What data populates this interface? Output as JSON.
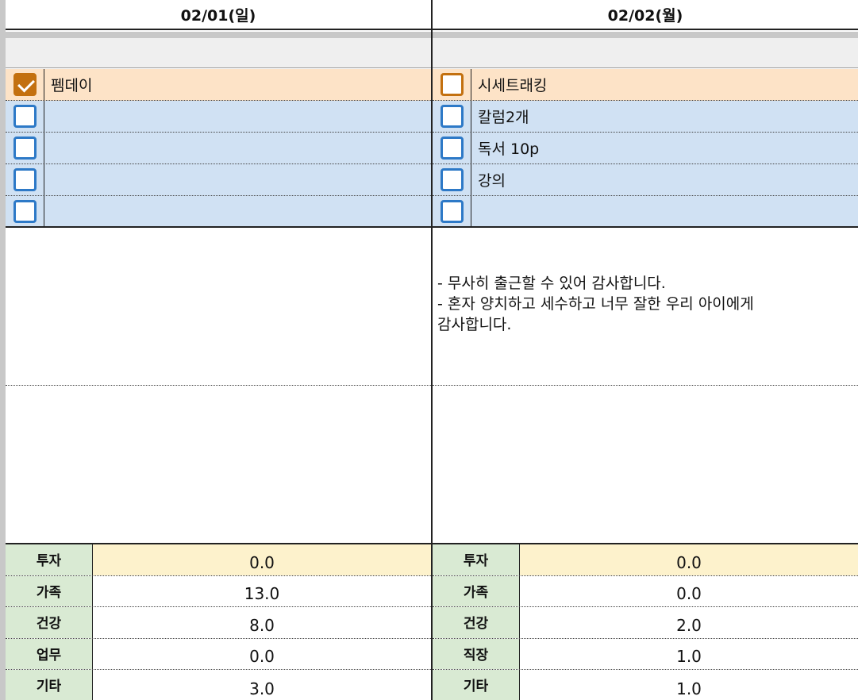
{
  "days": [
    {
      "date": "02/01(일)",
      "tasks": [
        {
          "label": "펨데이",
          "checked": true,
          "highlight": true
        },
        {
          "label": "",
          "checked": false,
          "highlight": false
        },
        {
          "label": "",
          "checked": false,
          "highlight": false
        },
        {
          "label": "",
          "checked": false,
          "highlight": false
        },
        {
          "label": "",
          "checked": false,
          "highlight": false
        }
      ],
      "note": "",
      "stats": [
        {
          "label": "투자",
          "value": "0.0"
        },
        {
          "label": "가족",
          "value": "13.0"
        },
        {
          "label": "건강",
          "value": "8.0"
        },
        {
          "label": "업무",
          "value": "0.0"
        },
        {
          "label": "기타",
          "value": "3.0"
        }
      ]
    },
    {
      "date": "02/02(월)",
      "tasks": [
        {
          "label": "시세트래킹",
          "checked": false,
          "highlight": true
        },
        {
          "label": "칼럼2개",
          "checked": false,
          "highlight": false
        },
        {
          "label": "독서 10p",
          "checked": false,
          "highlight": false
        },
        {
          "label": "강의",
          "checked": false,
          "highlight": false
        },
        {
          "label": "",
          "checked": false,
          "highlight": false
        }
      ],
      "note": "- 무사히 출근할 수 있어 감사합니다.\n- 혼자 양치하고 세수하고 너무 잘한 우리 아이에게\n감사합니다.",
      "stats": [
        {
          "label": "투자",
          "value": "0.0"
        },
        {
          "label": "가족",
          "value": "0.0"
        },
        {
          "label": "건강",
          "value": "2.0"
        },
        {
          "label": "직장",
          "value": "1.0"
        },
        {
          "label": "기타",
          "value": "1.0"
        }
      ]
    }
  ],
  "colors": {
    "checkbox_blue": "#2d79c7",
    "checkbox_orange": "#c3700f",
    "highlight_row": "#fde3c7",
    "task_row": "#d0e1f3",
    "stat_label_bg": "#d9ead3",
    "first_stat_bg": "#fdf2cc"
  }
}
